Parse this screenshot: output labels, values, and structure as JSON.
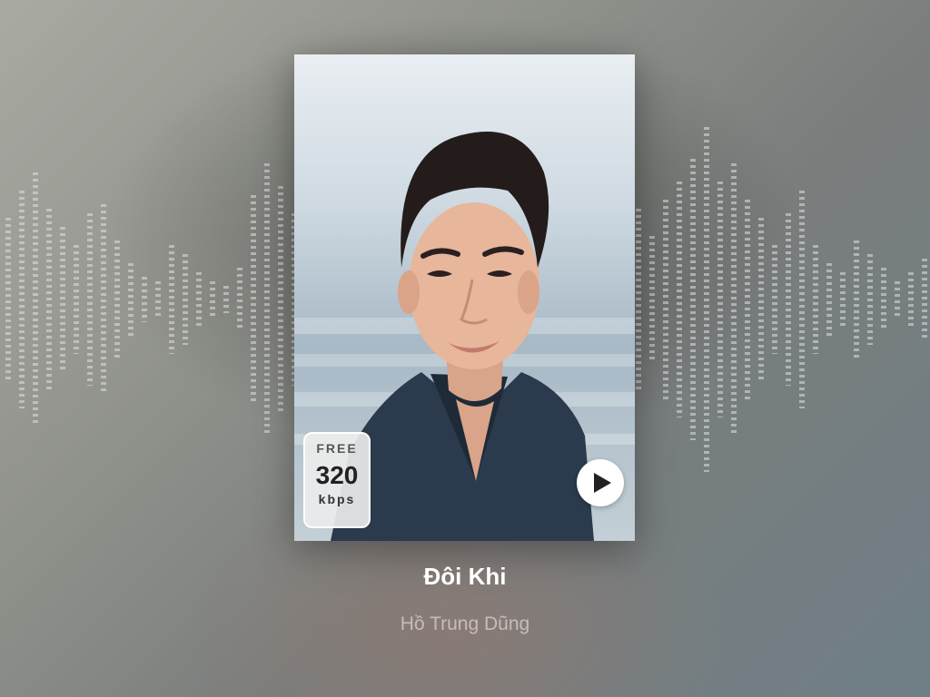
{
  "player": {
    "song_title": "Đôi Khi",
    "artist": "Hồ Trung Dũng",
    "quality_badge": {
      "tier": "FREE",
      "bitrate": "320",
      "unit": "kbps"
    },
    "play_icon": "play-icon",
    "waveform_icon": "audio-waveform"
  }
}
